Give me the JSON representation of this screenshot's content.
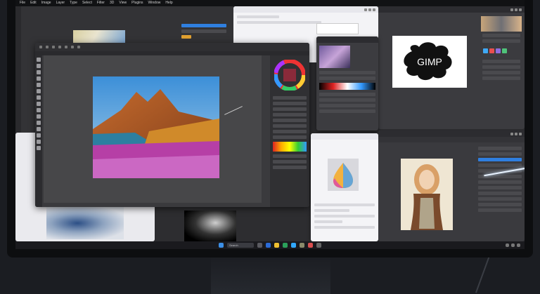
{
  "photoshop": {
    "menu": [
      "File",
      "Edit",
      "Image",
      "Layer",
      "Type",
      "Select",
      "Filter",
      "3D",
      "View",
      "Plugins",
      "Window",
      "Help"
    ]
  },
  "gimp": {
    "logo_text": "GIMP"
  },
  "taskbar": {
    "search_placeholder": "Search"
  },
  "colors": {
    "accent": "#2f7fe0",
    "bezel": "#0d0e10",
    "dark_ui": "#2b2b2e"
  },
  "icons": [
    "search-icon",
    "windows-start-icon",
    "color-wheel-icon",
    "gear-icon"
  ]
}
